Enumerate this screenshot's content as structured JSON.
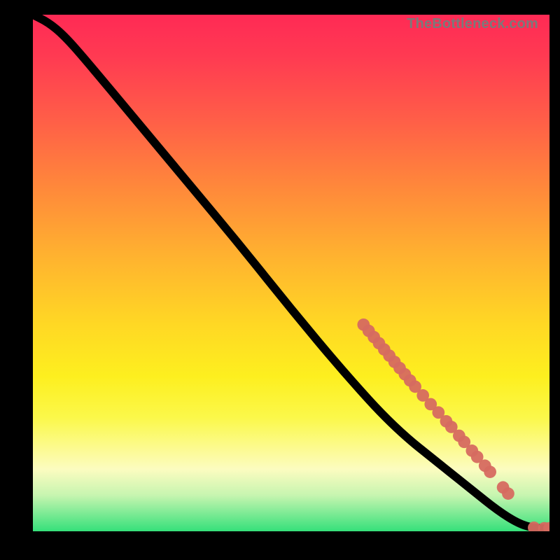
{
  "attribution": "TheBottleneck.com",
  "colors": {
    "page_bg": "#000000",
    "marker_fill": "#d66a60",
    "curve_stroke": "#000000",
    "gradient_stops": [
      "#ff2a55",
      "#ff3a52",
      "#ff5d48",
      "#ff8a3a",
      "#ffb030",
      "#ffd824",
      "#fdef1f",
      "#fbf84a",
      "#fcfcc0",
      "#c7f5b0",
      "#35e07a"
    ]
  },
  "chart_data": {
    "type": "line",
    "title": "",
    "xlabel": "",
    "ylabel": "",
    "xlim": [
      0,
      100
    ],
    "ylim": [
      0,
      100
    ],
    "grid": false,
    "curve": [
      {
        "x": 0.0,
        "y": 100.0
      },
      {
        "x": 3.0,
        "y": 98.5
      },
      {
        "x": 6.0,
        "y": 96.0
      },
      {
        "x": 10.0,
        "y": 91.5
      },
      {
        "x": 20.0,
        "y": 79.5
      },
      {
        "x": 30.0,
        "y": 67.5
      },
      {
        "x": 40.0,
        "y": 55.5
      },
      {
        "x": 50.0,
        "y": 43.0
      },
      {
        "x": 60.0,
        "y": 31.0
      },
      {
        "x": 70.0,
        "y": 20.0
      },
      {
        "x": 80.0,
        "y": 12.0
      },
      {
        "x": 85.0,
        "y": 8.0
      },
      {
        "x": 90.0,
        "y": 4.0
      },
      {
        "x": 94.0,
        "y": 1.5
      },
      {
        "x": 97.0,
        "y": 0.6
      },
      {
        "x": 100.0,
        "y": 0.5
      }
    ],
    "marker_radius": 1.2,
    "marker_points": [
      {
        "x": 64.0,
        "y": 40.0
      },
      {
        "x": 65.0,
        "y": 38.8
      },
      {
        "x": 66.0,
        "y": 37.6
      },
      {
        "x": 67.0,
        "y": 36.4
      },
      {
        "x": 68.0,
        "y": 35.2
      },
      {
        "x": 69.0,
        "y": 34.0
      },
      {
        "x": 70.0,
        "y": 32.8
      },
      {
        "x": 71.0,
        "y": 31.6
      },
      {
        "x": 72.0,
        "y": 30.4
      },
      {
        "x": 73.0,
        "y": 29.2
      },
      {
        "x": 74.0,
        "y": 28.0
      },
      {
        "x": 75.5,
        "y": 26.3
      },
      {
        "x": 77.0,
        "y": 24.6
      },
      {
        "x": 78.5,
        "y": 23.0
      },
      {
        "x": 80.0,
        "y": 21.3
      },
      {
        "x": 81.0,
        "y": 20.2
      },
      {
        "x": 82.5,
        "y": 18.5
      },
      {
        "x": 83.5,
        "y": 17.3
      },
      {
        "x": 85.0,
        "y": 15.6
      },
      {
        "x": 86.0,
        "y": 14.4
      },
      {
        "x": 87.5,
        "y": 12.7
      },
      {
        "x": 88.5,
        "y": 11.5
      },
      {
        "x": 91.0,
        "y": 8.5
      },
      {
        "x": 92.0,
        "y": 7.3
      },
      {
        "x": 97.0,
        "y": 0.7
      },
      {
        "x": 99.0,
        "y": 0.6
      },
      {
        "x": 100.0,
        "y": 0.6
      }
    ]
  }
}
